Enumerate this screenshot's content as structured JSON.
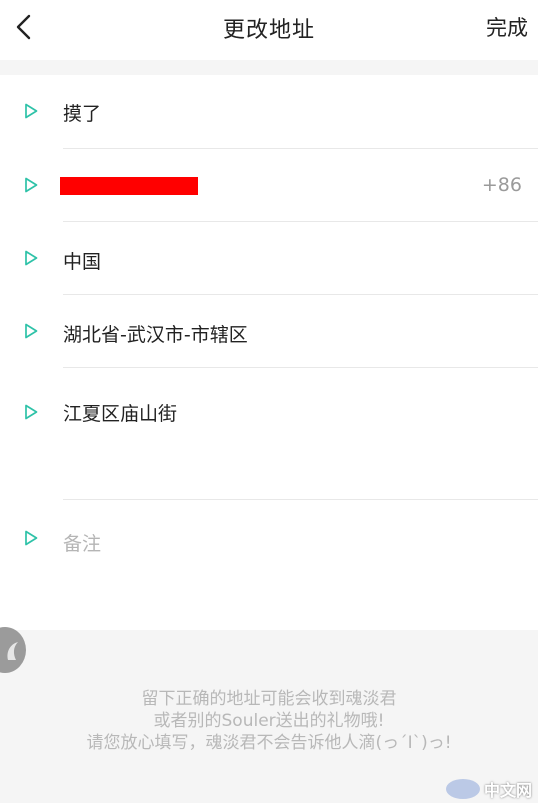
{
  "header": {
    "title": "更改地址",
    "done_label": "完成"
  },
  "form": {
    "name_value": "摸了",
    "phone_code": "+86",
    "country": "中国",
    "region": "湖北省-武汉市-市辖区",
    "street_value": "江夏区庙山街",
    "remark_placeholder": "备注"
  },
  "footer": {
    "line1": "留下正确的地址可能会收到魂淡君",
    "line2": "或者别的Souler送出的礼物哦!",
    "line3": "请您放心填写，魂淡君不会告诉他人滴(っ´Ι`)っ!"
  },
  "watermark": {
    "logo_text": "php",
    "site_text": "中文网"
  },
  "colors": {
    "accent": "#2ec2a8",
    "redacted": "#ff0000"
  },
  "icons": {
    "back": "chevron-left-icon",
    "row_marker": "triangle-right-icon",
    "avatar": "avatar"
  }
}
